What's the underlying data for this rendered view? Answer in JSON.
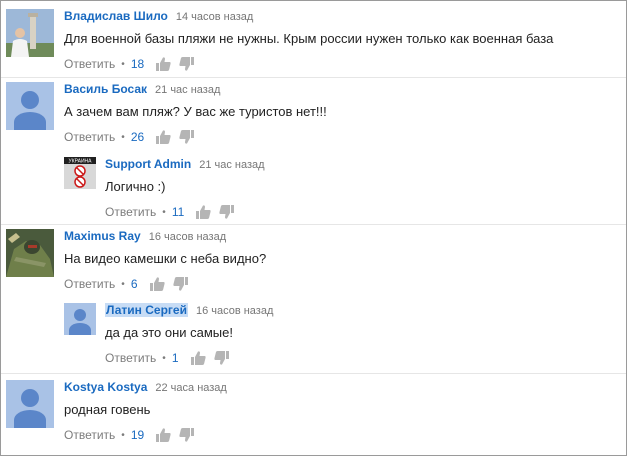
{
  "colors": {
    "author": "#1a6ac0",
    "likes": "#1a6ac0",
    "meta": "#767676",
    "avatar_bg": "#a9c2e6",
    "avatar_fg": "#5b86c9"
  },
  "comments": [
    {
      "author": "Владислав Шило",
      "time": "14 часов назад",
      "text": "Для военной базы пляжи  не нужны. Крым россии нужен только как военная база",
      "reply": "Ответить",
      "likes": "18",
      "avatar": "photo-man-by-tower"
    },
    {
      "author": "Василь Босак",
      "time": "21 час назад",
      "text": "А зачем вам пляж? У вас же туристов нет!!!",
      "reply": "Ответить",
      "likes": "26",
      "avatar": "default-user"
    },
    {
      "author": "Support Admin",
      "time": "21 час назад",
      "text": "Логично :)",
      "reply": "Ответить",
      "likes": "11",
      "avatar": "ukraine-no-symbols-sign"
    },
    {
      "author": "Maximus Ray",
      "time": "16 часов назад",
      "text": "На видео камешки с неба видно?",
      "reply": "Ответить",
      "likes": "6",
      "avatar": "armored-soldier-game-art"
    },
    {
      "author": "Латин Сергей",
      "time": "16 часов назад",
      "text": "да да это они самые!",
      "reply": "Ответить",
      "likes": "1",
      "avatar": "default-user"
    },
    {
      "author": "Kostya Kostya",
      "time": "22 часа назад",
      "text": "родная говень",
      "reply": "Ответить",
      "likes": "19",
      "avatar": "default-user"
    }
  ],
  "sign_label": "УКРАИНА"
}
